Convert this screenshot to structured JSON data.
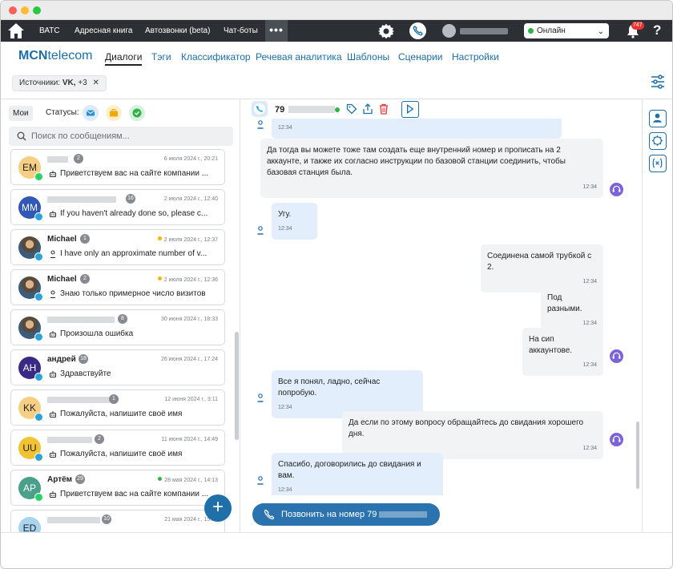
{
  "topnav": {
    "items": [
      "ВАТС",
      "Адресная книга",
      "Автозвонки (beta)",
      "Чат-боты"
    ],
    "more": "•••",
    "status": "Онлайн",
    "notifications": "747",
    "help": "?"
  },
  "colors": {
    "accent": "#1f6fa8",
    "online": "#2fb344",
    "warning": "#f5b500",
    "telegram": "#2aa3dc",
    "whatsapp": "#25d366",
    "operator": "#7b63d8"
  },
  "brand": {
    "bold": "MCN",
    "light": "telecom"
  },
  "menu": [
    "Диалоги",
    "Тэги",
    "Классификатор",
    "Речевая аналитика",
    "Шаблоны",
    "Сценарии",
    "Настройки"
  ],
  "filter": {
    "label": "Источники:",
    "value": "VK,",
    "more": "+3",
    "close": "✕"
  },
  "left": {
    "my_label": "Мои",
    "statuses_label": "Статусы:",
    "search_placeholder": "Поиск по сообщениям...",
    "conversations": [
      {
        "initials": "EM",
        "name": "",
        "count": "2",
        "date": "6 июля 2024 г., 20:21",
        "message": "Приветствуем вас на сайте компании ...",
        "channel": "whatsapp",
        "sender": "bot"
      },
      {
        "initials": "MM",
        "name": "",
        "count": "16",
        "date": "2 июля 2024 г., 12:40",
        "message": "If you haven't already done so, please c...",
        "channel": "telegram",
        "sender": "bot"
      },
      {
        "initials": "",
        "name": "Michael",
        "count": "1",
        "date": "2 июля 2024 г., 12:37",
        "message": "I have only an approximate number of v...",
        "channel": "telegram",
        "sender": "user"
      },
      {
        "initials": "",
        "name": "Michael",
        "count": "2",
        "date": "2 июля 2024 г., 12:36",
        "message": "Знаю только примерное число визитов",
        "channel": "telegram",
        "sender": "user"
      },
      {
        "initials": "",
        "name": "",
        "count": "8",
        "date": "30 июня 2024 г., 18:33",
        "message": "Произошла ошибка",
        "channel": "telegram",
        "sender": "bot"
      },
      {
        "initials": "AH",
        "name": "андрей",
        "count": "18",
        "date": "26 июня 2024 г., 17:24",
        "message": "Здравствуйте",
        "channel": "telegram",
        "sender": "bot"
      },
      {
        "initials": "KK",
        "name": "",
        "count": "1",
        "date": "12 июня 2024 г., 3:11",
        "message": "Пожалуйста, напишите своё имя",
        "channel": "telegram",
        "sender": "bot"
      },
      {
        "initials": "UU",
        "name": "",
        "count": "2",
        "date": "11 июня 2024 г., 14:49",
        "message": "Пожалуйста, напишите своё имя",
        "channel": "telegram",
        "sender": "bot"
      },
      {
        "initials": "AP",
        "name": "Артём",
        "count": "29",
        "date": "28 мая 2024 г., 14:13",
        "message": "Приветствуем вас на сайте компании ...",
        "channel": "whatsapp",
        "sender": "bot"
      },
      {
        "initials": "ED",
        "name": "",
        "count": "10",
        "date": "21 мая 2024 г., 15:34",
        "message": "",
        "channel": "telegram",
        "sender": "bot"
      }
    ],
    "fab": "+"
  },
  "chat": {
    "phone_prefix": "79",
    "messages": [
      {
        "side": "in",
        "text": "",
        "time": "12:34"
      },
      {
        "side": "out",
        "text": "Да тогда вы можете тоже там создать еще внутренний номер и прописать на 2 аккаунте, и также их согласно инструкции по базовой станции соединить, чтобы базовая станция была.",
        "time": "12:34"
      },
      {
        "side": "in",
        "text": "Угу.",
        "time": "12:34"
      },
      {
        "side": "out",
        "text": "Соединена самой трубкой с 2.",
        "time": "12:34"
      },
      {
        "side": "out",
        "text": "Под разными.",
        "time": "12:34"
      },
      {
        "side": "out",
        "text": "На сип аккаунтове.",
        "time": "12:34"
      },
      {
        "side": "in",
        "text": "Все я понял, ладно, сейчас попробую.",
        "time": "12:34"
      },
      {
        "side": "out",
        "text": "Да если по этому вопросу обращайтесь до свидания хорошего дня.",
        "time": "12:34"
      },
      {
        "side": "in",
        "text": "Спасибо, договорились до свидания и вам.",
        "time": "12:34"
      }
    ],
    "call_button": "Позвонить на номер  79"
  }
}
